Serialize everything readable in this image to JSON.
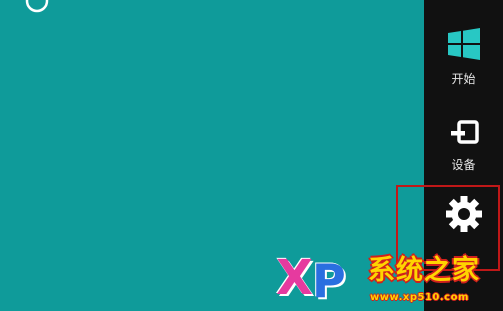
{
  "charms": {
    "start": {
      "label": "开始",
      "icon": "windows-logo-icon"
    },
    "devices": {
      "label": "设备",
      "icon": "devices-icon"
    },
    "settings": {
      "label": "",
      "icon": "gear-icon"
    }
  },
  "watermark": {
    "logo_x": "X",
    "logo_p": "P",
    "site_name": "系统之家",
    "url": "www.xp510.com"
  },
  "colors": {
    "desktop_bg": "#0f9b9a",
    "charms_bg": "#111111",
    "highlight": "#c01818",
    "start_icon": "#28c8c4"
  }
}
